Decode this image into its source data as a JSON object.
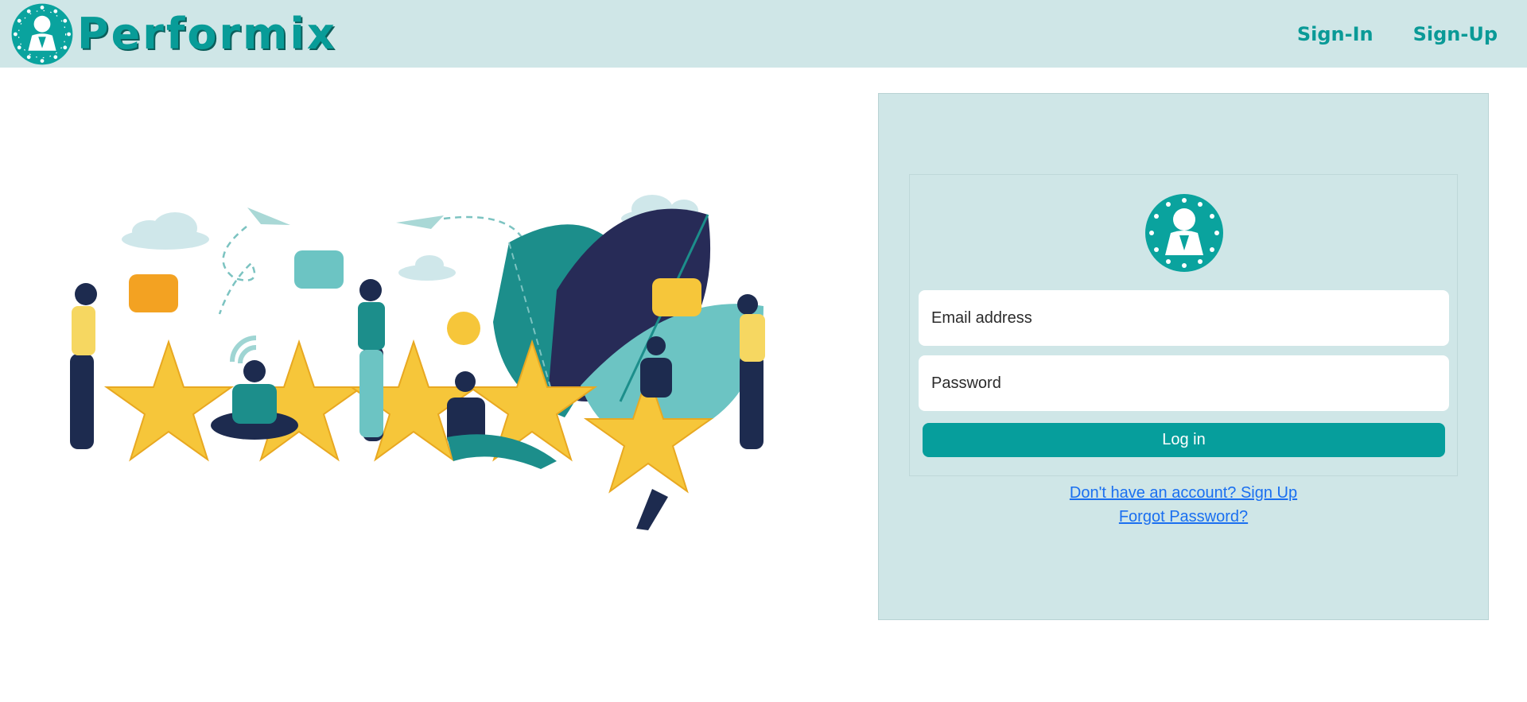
{
  "app": {
    "name": "Performix",
    "brand_color": "#089c98",
    "header_bg": "#cfe6e7"
  },
  "nav": {
    "signin": "Sign-In",
    "signup": "Sign-Up"
  },
  "login": {
    "email_placeholder": "Email address",
    "password_placeholder": "Password",
    "button_label": "Log in",
    "signup_link": "Don't have an account? Sign Up",
    "forgot_link": "Forgot Password?",
    "button_color": "#069e9c",
    "link_color": "#1a6ff0"
  },
  "icons": {
    "brand_logo": "person-badge-stars-icon",
    "card_logo": "person-badge-stars-icon"
  }
}
